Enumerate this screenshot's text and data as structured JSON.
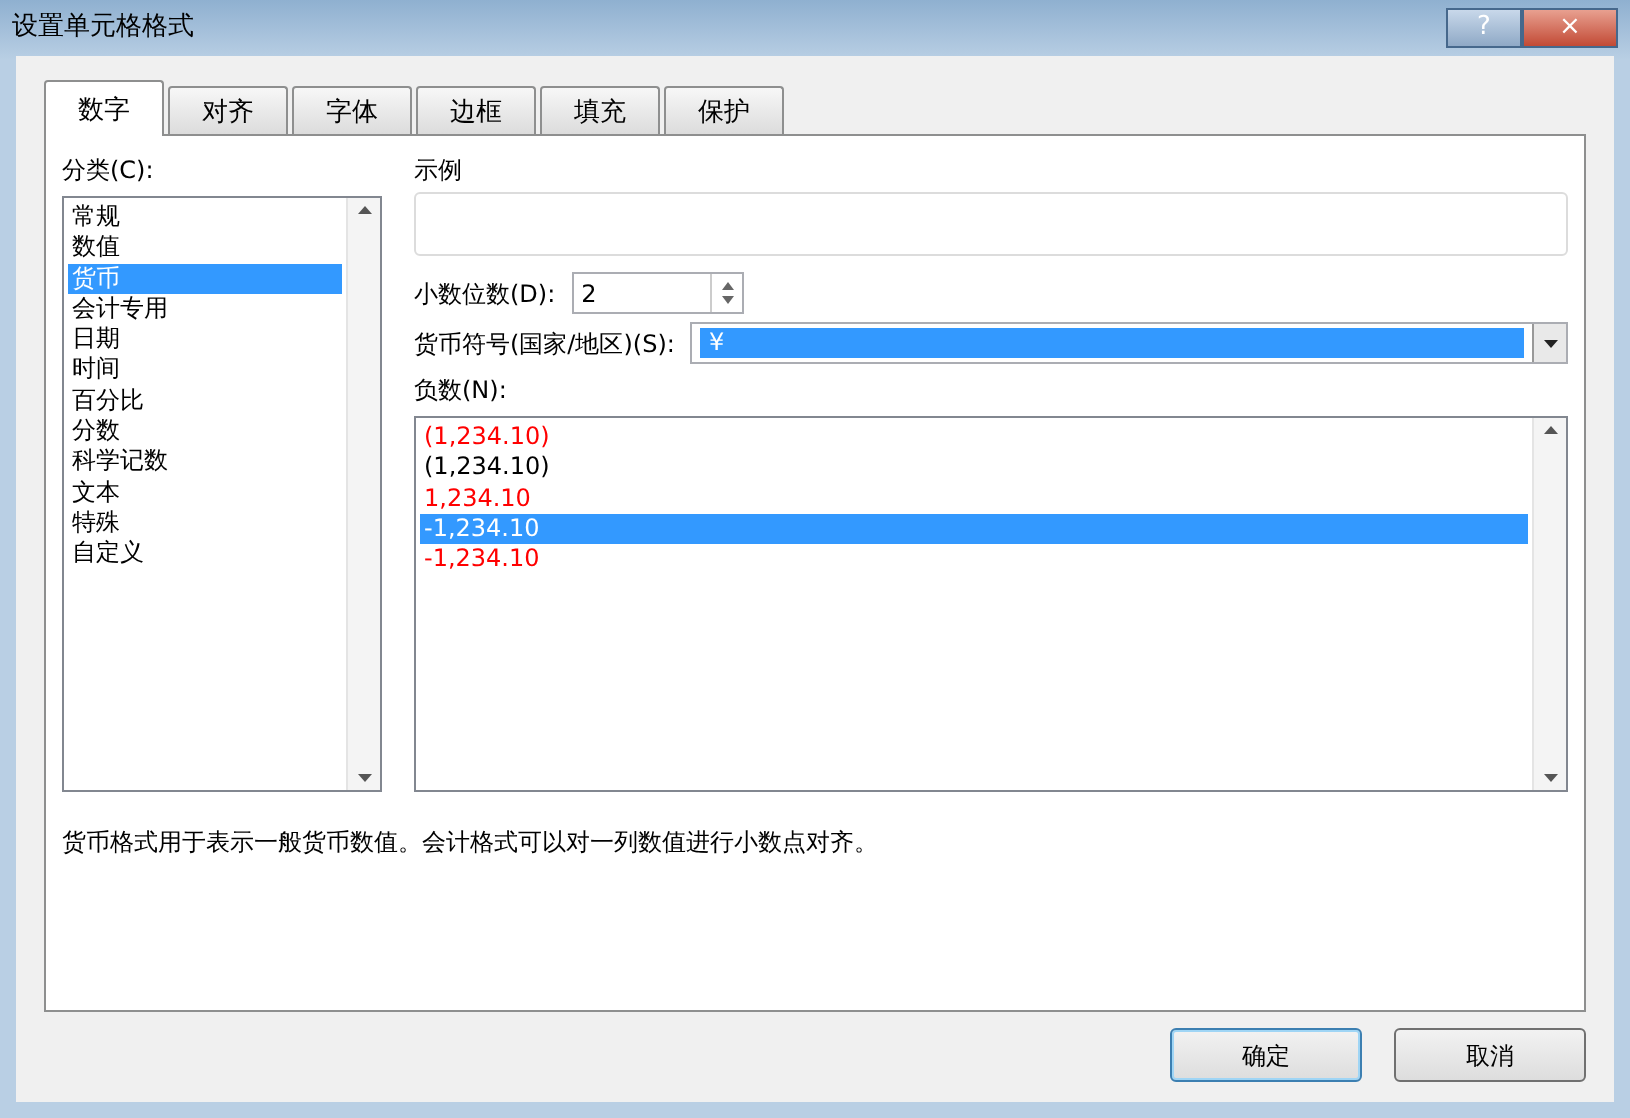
{
  "window": {
    "title": "设置单元格格式",
    "help": "?",
    "close": "×"
  },
  "tabs": [
    {
      "label": "数字",
      "selected": true
    },
    {
      "label": "对齐",
      "selected": false
    },
    {
      "label": "字体",
      "selected": false
    },
    {
      "label": "边框",
      "selected": false
    },
    {
      "label": "填充",
      "selected": false
    },
    {
      "label": "保护",
      "selected": false
    }
  ],
  "category": {
    "label": "分类(C):",
    "items": [
      {
        "label": "常规",
        "selected": false
      },
      {
        "label": "数值",
        "selected": false
      },
      {
        "label": "货币",
        "selected": true
      },
      {
        "label": "会计专用",
        "selected": false
      },
      {
        "label": "日期",
        "selected": false
      },
      {
        "label": "时间",
        "selected": false
      },
      {
        "label": "百分比",
        "selected": false
      },
      {
        "label": "分数",
        "selected": false
      },
      {
        "label": "科学记数",
        "selected": false
      },
      {
        "label": "文本",
        "selected": false
      },
      {
        "label": "特殊",
        "selected": false
      },
      {
        "label": "自定义",
        "selected": false
      }
    ]
  },
  "sample": {
    "label": "示例"
  },
  "decimal_places": {
    "label": "小数位数(D):",
    "value": "2"
  },
  "currency_symbol": {
    "label": "货币符号(国家/地区)(S):",
    "value": "¥"
  },
  "negative_numbers": {
    "label": "负数(N):",
    "items": [
      {
        "text": "(1,234.10)",
        "color": "#ff0000",
        "selected": false
      },
      {
        "text": "(1,234.10)",
        "color": "#000000",
        "selected": false
      },
      {
        "text": "1,234.10",
        "color": "#ff0000",
        "selected": false
      },
      {
        "text": "-1,234.10",
        "selected": true
      },
      {
        "text": "-1,234.10",
        "color": "#ff0000",
        "selected": false
      }
    ]
  },
  "description": "货币格式用于表示一般货币数值。会计格式可以对一列数值进行小数点对齐。",
  "buttons": [
    {
      "label": "确定",
      "default": true
    },
    {
      "label": "取消",
      "default": false
    }
  ]
}
